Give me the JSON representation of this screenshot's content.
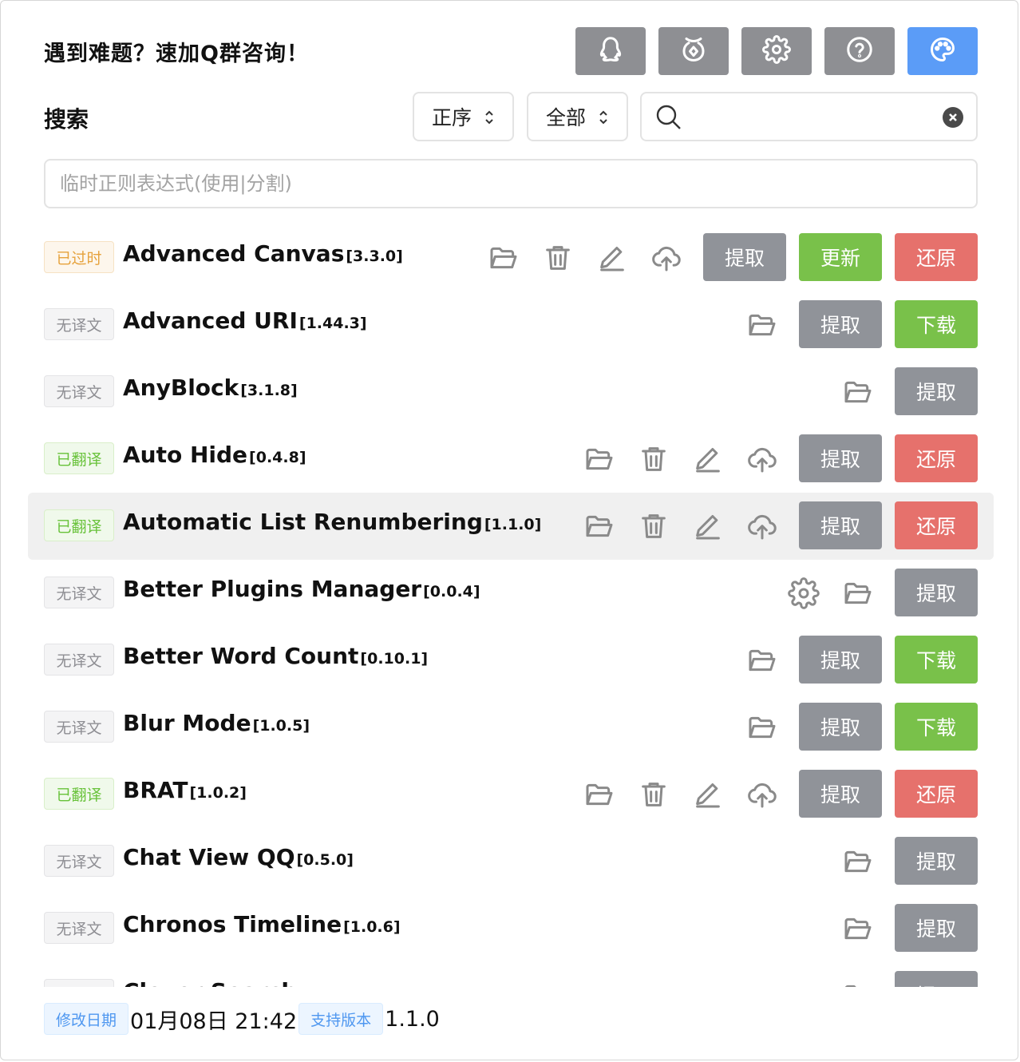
{
  "header": {
    "title": "遇到难题？速加Q群咨询！",
    "buttons": [
      {
        "icon": "qq-icon"
      },
      {
        "icon": "coin-bag-icon"
      },
      {
        "icon": "gear-icon"
      },
      {
        "icon": "help-circle-icon"
      },
      {
        "icon": "palette-icon",
        "color": "#5b9cf7"
      }
    ]
  },
  "search": {
    "label": "搜索",
    "sort_value": "正序",
    "filter_value": "全部",
    "query_value": "",
    "regex_placeholder": "临时正则表达式(使用|分割)"
  },
  "colors": {
    "gray_button": "#909399",
    "green_button": "#79c14a",
    "red_button": "#e6716c",
    "badge_translated": "#68c23a",
    "badge_outdated": "#e6a23c",
    "badge_untranslated": "#8e8e93"
  },
  "plugins": [
    {
      "badge": "已过时",
      "status": "old",
      "name": "Advanced Canvas",
      "version": "[3.3.0]",
      "icons": [
        "folder-icon",
        "trash-icon",
        "edit-icon",
        "upload-icon"
      ],
      "buttons": [
        "提取",
        "更新",
        "还原"
      ]
    },
    {
      "badge": "无译文",
      "status": "none",
      "name": "Advanced URI",
      "version": "[1.44.3]",
      "icons": [
        "folder-icon"
      ],
      "buttons": [
        "提取",
        "下载"
      ]
    },
    {
      "badge": "无译文",
      "status": "none",
      "name": "AnyBlock",
      "version": "[3.1.8]",
      "icons": [
        "folder-icon"
      ],
      "buttons": [
        "提取"
      ]
    },
    {
      "badge": "已翻译",
      "status": "done",
      "name": "Auto Hide",
      "version": "[0.4.8]",
      "icons": [
        "folder-icon",
        "trash-icon",
        "edit-icon",
        "upload-icon"
      ],
      "buttons": [
        "提取",
        "还原"
      ]
    },
    {
      "badge": "已翻译",
      "status": "done",
      "name": "Automatic List Renumbering",
      "version": "[1.1.0]",
      "icons": [
        "folder-icon",
        "trash-icon",
        "edit-icon",
        "upload-icon"
      ],
      "buttons": [
        "提取",
        "还原"
      ],
      "highlight": true
    },
    {
      "badge": "无译文",
      "status": "none",
      "name": "Better Plugins Manager",
      "version": "[0.0.4]",
      "icons": [
        "gear-icon",
        "folder-icon"
      ],
      "buttons": [
        "提取"
      ]
    },
    {
      "badge": "无译文",
      "status": "none",
      "name": "Better Word Count",
      "version": "[0.10.1]",
      "icons": [
        "folder-icon"
      ],
      "buttons": [
        "提取",
        "下载"
      ]
    },
    {
      "badge": "无译文",
      "status": "none",
      "name": "Blur Mode",
      "version": "[1.0.5]",
      "icons": [
        "folder-icon"
      ],
      "buttons": [
        "提取",
        "下载"
      ]
    },
    {
      "badge": "已翻译",
      "status": "done",
      "name": "BRAT",
      "version": "[1.0.2]",
      "icons": [
        "folder-icon",
        "trash-icon",
        "edit-icon",
        "upload-icon"
      ],
      "buttons": [
        "提取",
        "还原"
      ]
    },
    {
      "badge": "无译文",
      "status": "none",
      "name": "Chat View QQ",
      "version": "[0.5.0]",
      "icons": [
        "folder-icon"
      ],
      "buttons": [
        "提取"
      ]
    },
    {
      "badge": "无译文",
      "status": "none",
      "name": "Chronos Timeline",
      "version": "[1.0.6]",
      "icons": [
        "folder-icon"
      ],
      "buttons": [
        "提取"
      ]
    },
    {
      "badge": "无译文",
      "status": "none",
      "name": "Clever Search",
      "version": "",
      "icons": [
        "folder-icon"
      ],
      "buttons": [
        "提取"
      ]
    }
  ],
  "footer": {
    "modified_label": "修改日期",
    "modified_value": "01月08日 21:42",
    "version_label": "支持版本",
    "version_value": "1.1.0"
  }
}
